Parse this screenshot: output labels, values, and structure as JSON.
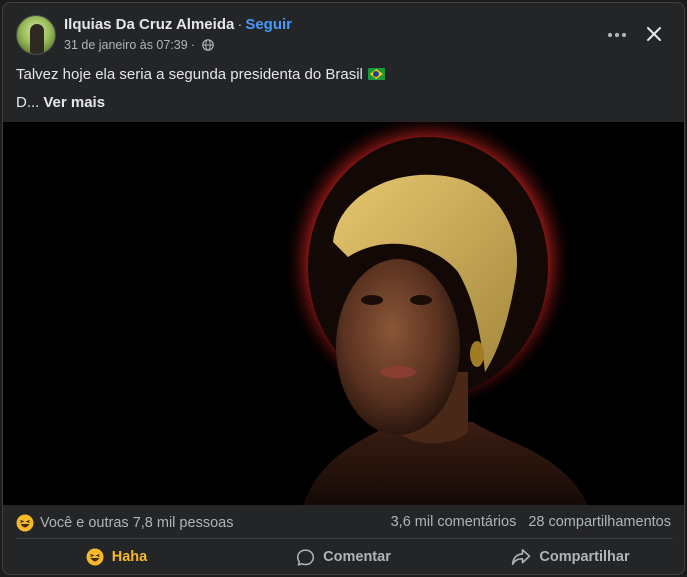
{
  "post": {
    "author_name": "Ilquias Da Cruz Almeida",
    "separator": "·",
    "follow_label": "Seguir",
    "timestamp": "31 de janeiro às 07:39",
    "meta_separator": "·",
    "privacy_icon": "globe-icon",
    "text_line1": "Talvez hoje ela seria a segunda presidenta do Brasil",
    "flag_icon": "brazil-flag-icon",
    "text_line2_prefix": "D...",
    "see_more_label": "Ver mais",
    "image": {
      "subject": "portrait of a woman wearing a yellow headwrap against a dark background",
      "background_color": "#000000"
    }
  },
  "stats": {
    "reaction_icon": "haha-emoji-icon",
    "reactions_text": "Você e outras 7,8 mil pessoas",
    "comments_text": "3,6 mil comentários",
    "shares_text": "28 compartilhamentos"
  },
  "actions": {
    "reaction_label": "Haha",
    "reaction_color": "#f7b928",
    "comment_label": "Comentar",
    "share_label": "Compartilhar"
  },
  "colors": {
    "card_background": "#242526",
    "link_blue": "#4599ff",
    "secondary_text": "#b0b3b8",
    "primary_text": "#e4e6eb"
  }
}
